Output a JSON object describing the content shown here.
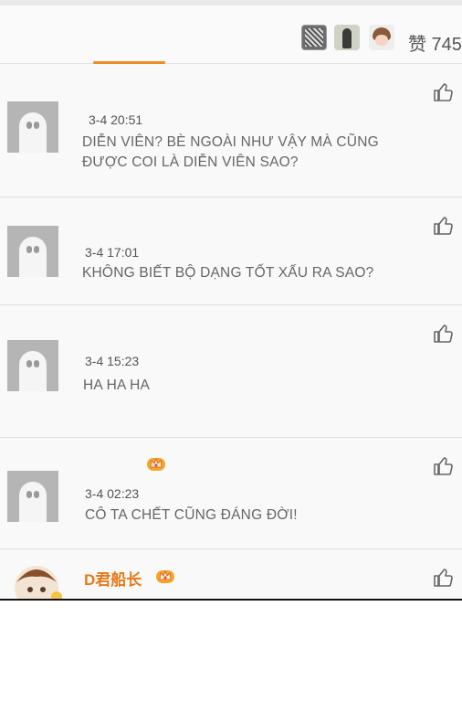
{
  "header": {
    "likes_label": "赞 745",
    "liker_avatars": [
      "liker-avatar-1",
      "liker-avatar-2",
      "liker-avatar-3"
    ],
    "accent_color": "#f08a24"
  },
  "comments": [
    {
      "time": "3-4  20:51",
      "lines": [
        "DIỄN VIÊN? BÈ NGOÀI NHƯ VẬY MÀ CŨNG",
        "ĐƯỢC COI LÀ DIỄN VIÊN SAO?"
      ]
    },
    {
      "time": "3-4 17:01",
      "lines": [
        "KHÔNG BIẾT BỘ DẠNG TỐT XẤU RA SAO?"
      ]
    },
    {
      "time": "3-4 15:23",
      "lines": [
        "HA HA HA"
      ]
    },
    {
      "time": "3-4 02:23",
      "lines": [
        "CÔ TA CHẾT CŨNG ĐÁNG ĐỜI!"
      ]
    }
  ],
  "last_comment": {
    "username": "D君船长"
  },
  "icons": {
    "like": "thumbs-up-icon",
    "badge": "crown-badge-icon",
    "avatar": "default-avatar-icon"
  },
  "colors": {
    "username": "#e8791a",
    "badge": "#f5a623"
  }
}
